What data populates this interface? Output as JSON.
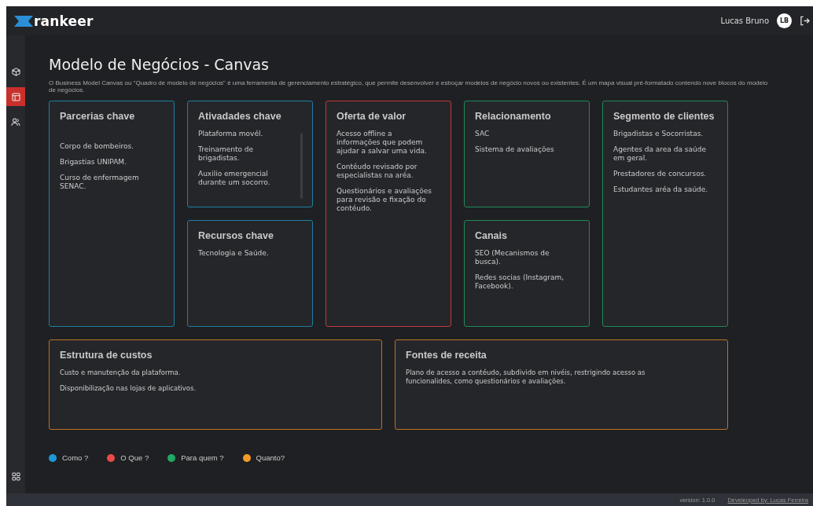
{
  "header": {
    "logo": "rankeer",
    "user_name": "Lucas Bruno",
    "avatar_initials": "LB"
  },
  "sidebar": {
    "items": [
      {
        "selected": false
      },
      {
        "selected": true
      },
      {
        "selected": false
      }
    ]
  },
  "page": {
    "title": "Modelo de Negócios - Canvas",
    "description": "O Business Model Canvas ou \"Quadro de modelo de negócios\" é uma ferramenta de gerenciamento estratégico, que permite desenvolver e esboçar modelos de negócio novos ou existentes. É um mapa visual pré-formatado contendo nove blocos do modelo de negócios."
  },
  "blocks": [
    {
      "title": "Parcerias chave",
      "color": "#1d7fa0",
      "items": [
        "Corpo de bombeiros.",
        "Brigastias UNIPAM.",
        "Curso de enfermagem SENAC."
      ]
    },
    {
      "title": "Ativadades chave",
      "color": "#1d7fa0",
      "items": [
        "Plataforma movél.",
        "Treinamento de brigadistas.",
        "Auxilio emergencial durante um socorro."
      ]
    },
    {
      "title": "Recursos chave",
      "color": "#1d7fa0",
      "items": [
        "Tecnologia e Saúde."
      ]
    },
    {
      "title": "Oferta de valor",
      "color": "#c0393b",
      "items": [
        "Acesso offline a informações que podem ajudar a salvar uma vida.",
        "Contéudo revisado por especialistas na aréa.",
        "Questionários e avaliações para revisão e fixação do contéudo."
      ]
    },
    {
      "title": "Relacionamento",
      "color": "#1f8a5a",
      "items": [
        "SAC",
        "Sistema de avaliações"
      ]
    },
    {
      "title": "Canais",
      "color": "#1f8a5a",
      "items": [
        "SEO (Mecanismos de busca).",
        "Redes socias (Instagram, Facebook)."
      ]
    },
    {
      "title": "Segmento de clientes",
      "color": "#1f8a5a",
      "items": [
        "Brigadistas e Socorristas.",
        "Agentes da area da saúde em geral.",
        "Prestadores de concursos.",
        "Estudantes aréa da saúde."
      ]
    },
    {
      "title": "Estrutura de custos",
      "color": "#b8741f",
      "items": [
        "Custo e manutenção da plataforma.",
        "Disponibilização nas lojas de aplicativos."
      ]
    },
    {
      "title": "Fontes de receita",
      "color": "#b8741f",
      "items": [
        "Plano de acesso a contéudo, subdivido em nivéis, restrigindo acesso as funcionalides, como questionários e avaliações."
      ]
    }
  ],
  "legend": [
    {
      "label": "Como ?",
      "color": "#1a9ad6"
    },
    {
      "label": "O Que ?",
      "color": "#e84a4a"
    },
    {
      "label": "Para quem ?",
      "color": "#1fa866"
    },
    {
      "label": "Quanto?",
      "color": "#f59a2a"
    }
  ],
  "footer": {
    "version": "version: 1.0.0",
    "credit": "Develeoped by: Lucas Ferreira"
  }
}
